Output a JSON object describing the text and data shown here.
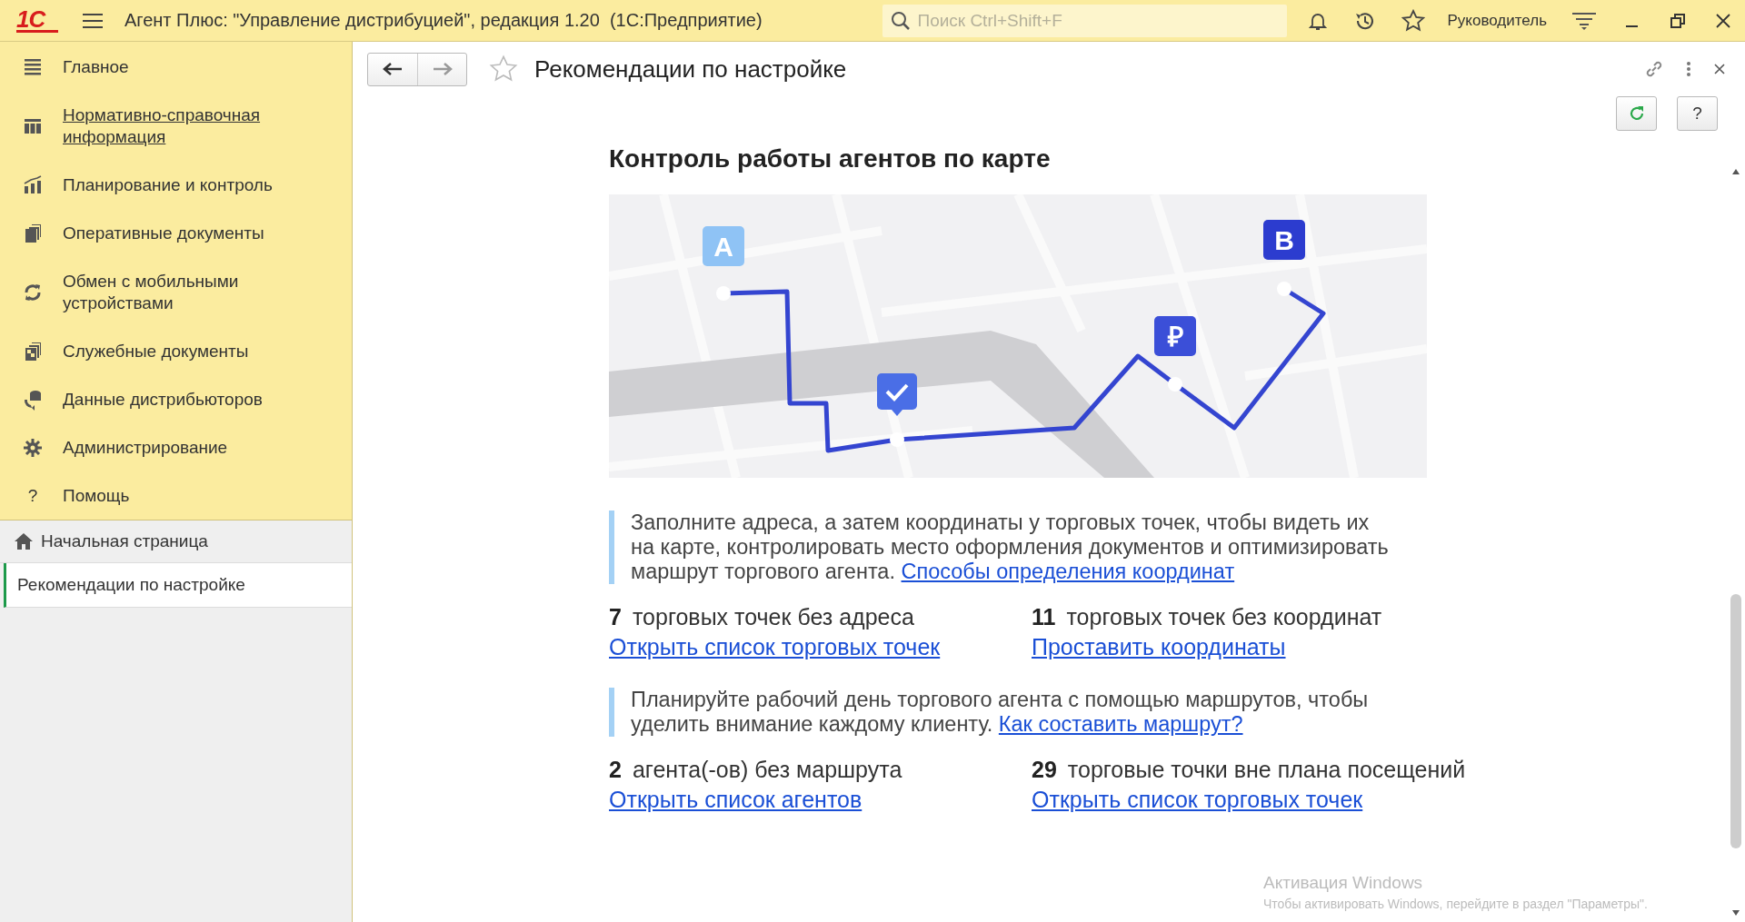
{
  "title_bar": {
    "logo": "1С",
    "app_title": "Агент Плюс: \"Управление дистрибуцией\", редакция 1.20  (1С:Предприятие)",
    "search_placeholder": "Поиск Ctrl+Shift+F",
    "user": "Руководитель"
  },
  "sidebar": {
    "items": [
      {
        "label": "Главное",
        "hovered": false
      },
      {
        "label": "Нормативно-справочная информация",
        "hovered": true
      },
      {
        "label": "Планирование и контроль",
        "hovered": false
      },
      {
        "label": "Оперативные документы",
        "hovered": false
      },
      {
        "label": "Обмен с мобильными устройствами",
        "hovered": false
      },
      {
        "label": "Служебные документы",
        "hovered": false
      },
      {
        "label": "Данные дистрибьюторов",
        "hovered": false
      },
      {
        "label": "Администрирование",
        "hovered": false
      },
      {
        "label": "Помощь",
        "hovered": false,
        "glyph": "?"
      }
    ]
  },
  "open_windows": [
    {
      "label": "Начальная страница",
      "selected": false
    },
    {
      "label": "Рекомендации по настройке",
      "selected": true
    }
  ],
  "form": {
    "title": "Рекомендации по настройке",
    "help_button": "?",
    "heading": "Контроль работы агентов по карте",
    "map": {
      "pins": [
        "A",
        "₽",
        "B"
      ]
    },
    "sections": [
      {
        "info": {
          "text": "Заполните адреса, а затем координаты у торговых точек, чтобы видеть их на карте, контролировать место оформления документов и оптимизировать маршрут торгового агента.",
          "link": "Способы определения координат"
        },
        "stats": [
          {
            "count": "7",
            "label": "торговых точек без адреса",
            "link": "Открыть список торговых точек"
          },
          {
            "count": "11",
            "label": "торговых точек без координат",
            "link": "Проставить координаты"
          }
        ]
      },
      {
        "info": {
          "text": "Планируйте рабочий день торгового агента с помощью маршрутов, чтобы уделить внимание каждому клиенту.",
          "link": "Как составить маршрут?"
        },
        "stats": [
          {
            "count": "2",
            "label": "агента(-ов) без маршрута",
            "link": "Открыть список агентов"
          },
          {
            "count": "29",
            "label": "торговые точки вне плана посещений",
            "link": "Открыть список торговых точек"
          }
        ]
      }
    ]
  },
  "watermark": {
    "title": "Активация Windows",
    "text": "Чтобы активировать Windows, перейдите в раздел \"Параметры\"."
  }
}
